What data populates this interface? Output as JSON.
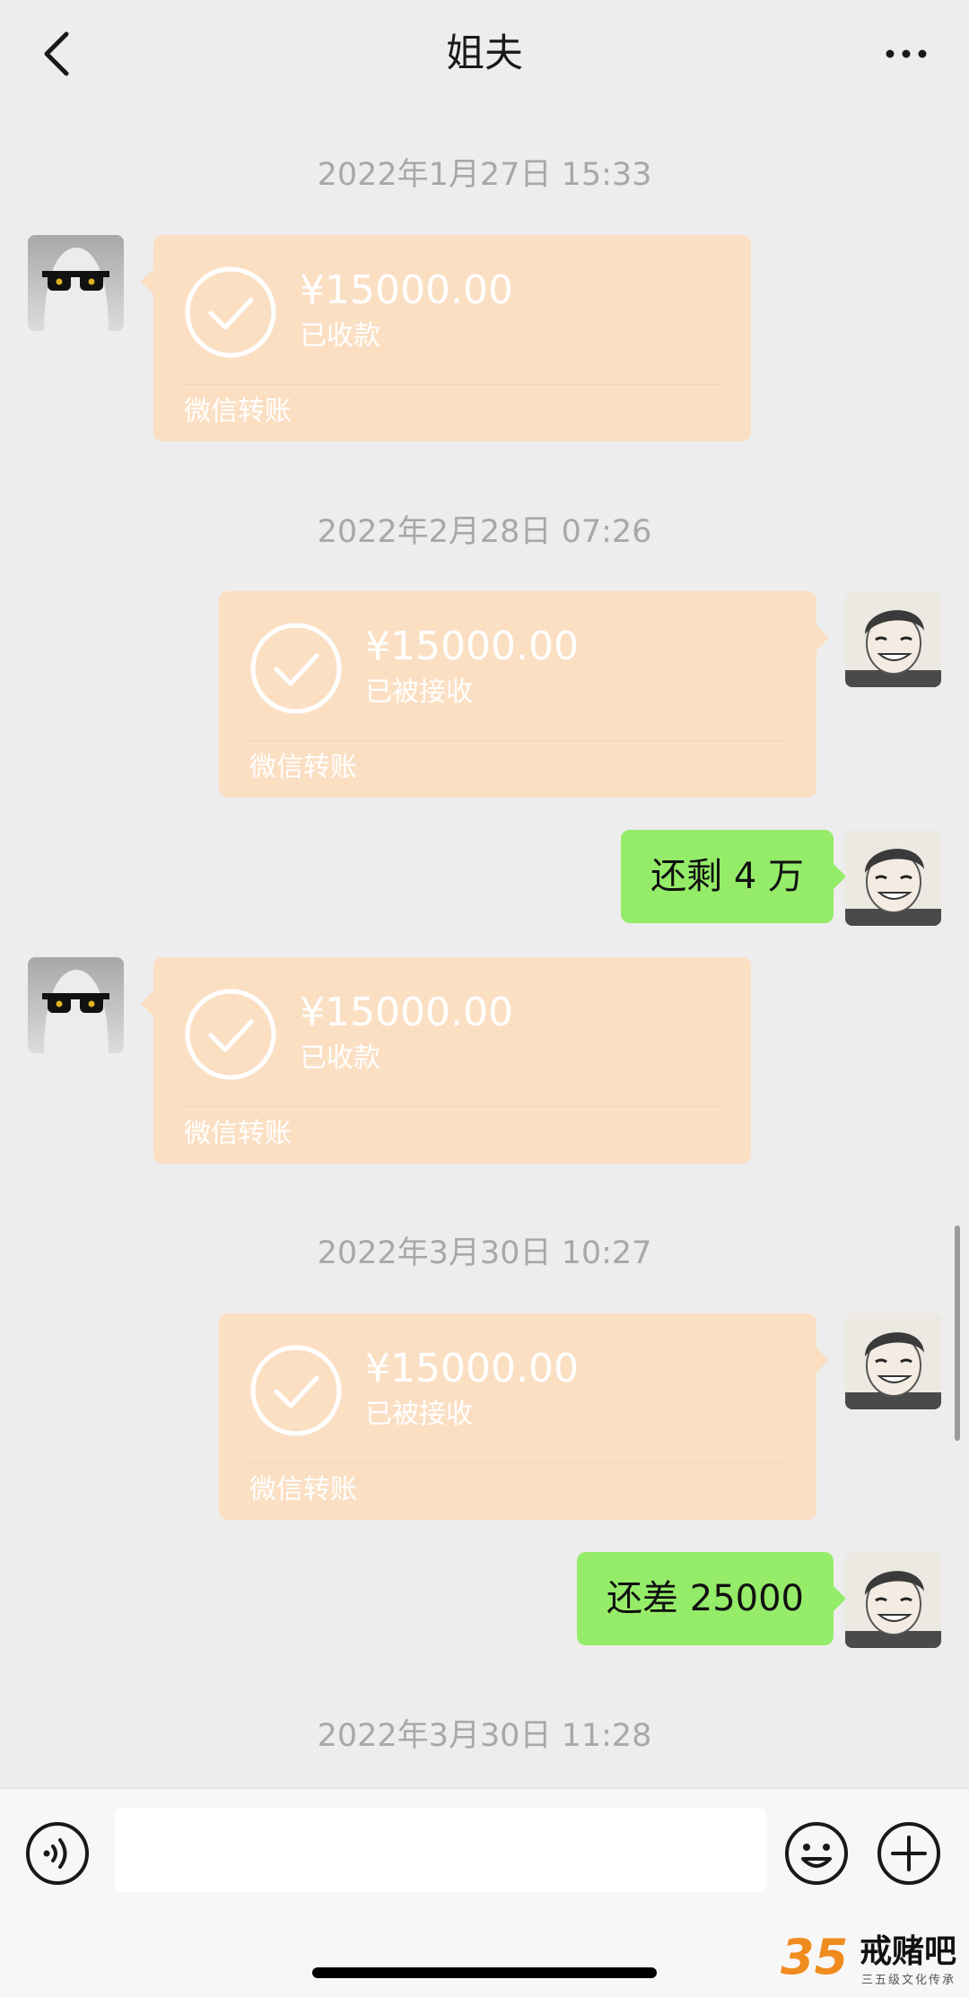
{
  "header": {
    "title": "姐夫"
  },
  "messages": [
    {
      "type": "timestamp",
      "text": "2022年1月27日 15:33"
    },
    {
      "type": "transfer",
      "side": "left",
      "amount": "¥15000.00",
      "status": "已收款",
      "label": "微信转账"
    },
    {
      "type": "timestamp",
      "text": "2022年2月28日 07:26"
    },
    {
      "type": "transfer",
      "side": "right",
      "amount": "¥15000.00",
      "status": "已被接收",
      "label": "微信转账"
    },
    {
      "type": "text",
      "side": "right",
      "text": "还剩 4 万"
    },
    {
      "type": "transfer",
      "side": "left",
      "amount": "¥15000.00",
      "status": "已收款",
      "label": "微信转账"
    },
    {
      "type": "timestamp",
      "text": "2022年3月30日 10:27"
    },
    {
      "type": "transfer",
      "side": "right",
      "amount": "¥15000.00",
      "status": "已被接收",
      "label": "微信转账"
    },
    {
      "type": "text",
      "side": "right",
      "text": "还差 25000"
    },
    {
      "type": "timestamp",
      "text": "2022年3月30日 11:28"
    }
  ],
  "input": {
    "value": "",
    "placeholder": ""
  },
  "icons": {
    "back": "chevron-left-icon",
    "more": "more-dots-icon",
    "voice": "voice-icon",
    "emoji": "emoji-icon",
    "plus": "plus-icon",
    "check": "check-circle-icon"
  },
  "colors": {
    "background": "#ededed",
    "transfer_bubble": "#fbdfc3",
    "text_bubble": "#95ec69",
    "timestamp_text": "#a8a8a8"
  },
  "watermark": {
    "number": "35",
    "name": "戒赌吧",
    "subtitle": "三五级文化传承"
  }
}
